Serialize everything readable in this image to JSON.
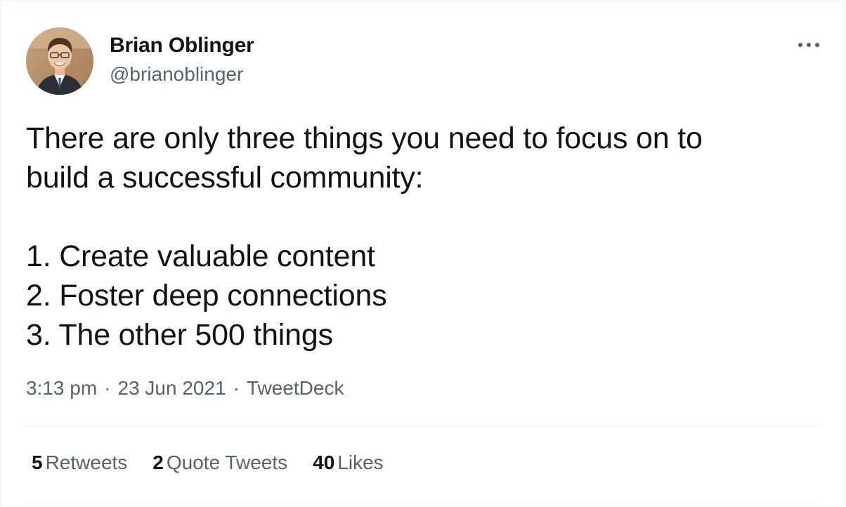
{
  "author": {
    "name": "Brian Oblinger",
    "handle": "@brianoblinger",
    "avatar_icon": "profile-photo"
  },
  "more_icon": "ellipsis-icon",
  "tweet": {
    "text": "There are only three things you need to focus on to\nbuild a successful community:\n\n1. Create valuable content\n2. Foster deep connections\n3. The other 500 things"
  },
  "meta": {
    "time": "3:13 pm",
    "date": "23 Jun 2021",
    "source": "TweetDeck",
    "separator": "·"
  },
  "stats": {
    "retweets_count": "5",
    "retweets_label": "Retweets",
    "quotes_count": "2",
    "quotes_label": "Quote Tweets",
    "likes_count": "40",
    "likes_label": "Likes"
  },
  "colors": {
    "primary_text": "#0f1419",
    "secondary_text": "#536471",
    "divider": "#eff3f4"
  }
}
